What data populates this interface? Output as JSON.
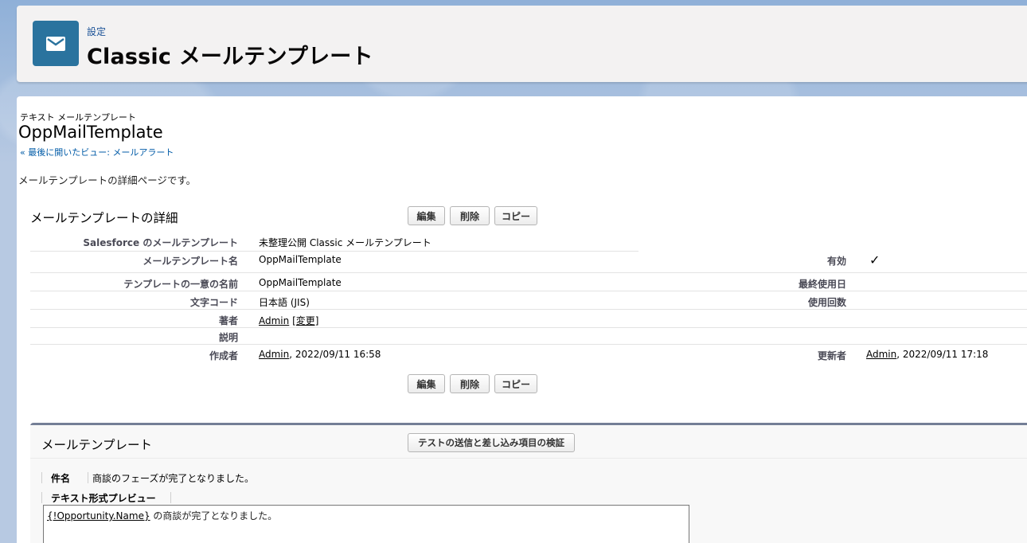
{
  "header": {
    "eyebrow": "設定",
    "title": "Classic メールテンプレート",
    "icon": "envelope-icon",
    "icon_color": "#2a739e"
  },
  "record": {
    "type_label": "テキスト メールテンプレート",
    "name": "OppMailTemplate",
    "back_link": "« 最後に開いたビュー: メールアラート",
    "description": "メールテンプレートの詳細ページです。"
  },
  "detail": {
    "title": "メールテンプレートの詳細",
    "buttons": {
      "edit": "編集",
      "delete": "削除",
      "copy": "コピー"
    },
    "fields": {
      "folder_label": "Salesforce のメールテンプレート",
      "folder_value": "未整理公開 Classic メールテンプレート",
      "template_name_label": "メールテンプレート名",
      "template_name_value": "OppMailTemplate",
      "active_label": "有効",
      "active_value": "✓",
      "unique_name_label": "テンプレートの一意の名前",
      "unique_name_value": "OppMailTemplate",
      "last_used_label": "最終使用日",
      "last_used_value": "",
      "encoding_label": "文字コード",
      "encoding_value": "日本語 (JIS)",
      "times_used_label": "使用回数",
      "times_used_value": "",
      "author_label": "著者",
      "author_link": "Admin",
      "author_change": "[変更]",
      "description_label": "説明",
      "description_value": "",
      "created_by_label": "作成者",
      "created_by_link": "Admin",
      "created_by_date": ", 2022/09/11 16:58",
      "modified_by_label": "更新者",
      "modified_by_link": "Admin",
      "modified_by_date": ", 2022/09/11 17:18"
    }
  },
  "mail_template": {
    "title": "メールテンプレート",
    "test_button": "テストの送信と差し込み項目の検証",
    "subject_label": "件名",
    "subject_value": "商談のフェーズが完了となりました。",
    "preview_label": "テキスト形式プレビュー",
    "preview_merge_field": "{!Opportunity.Name}",
    "preview_text": " の商談が完了となりました。"
  }
}
